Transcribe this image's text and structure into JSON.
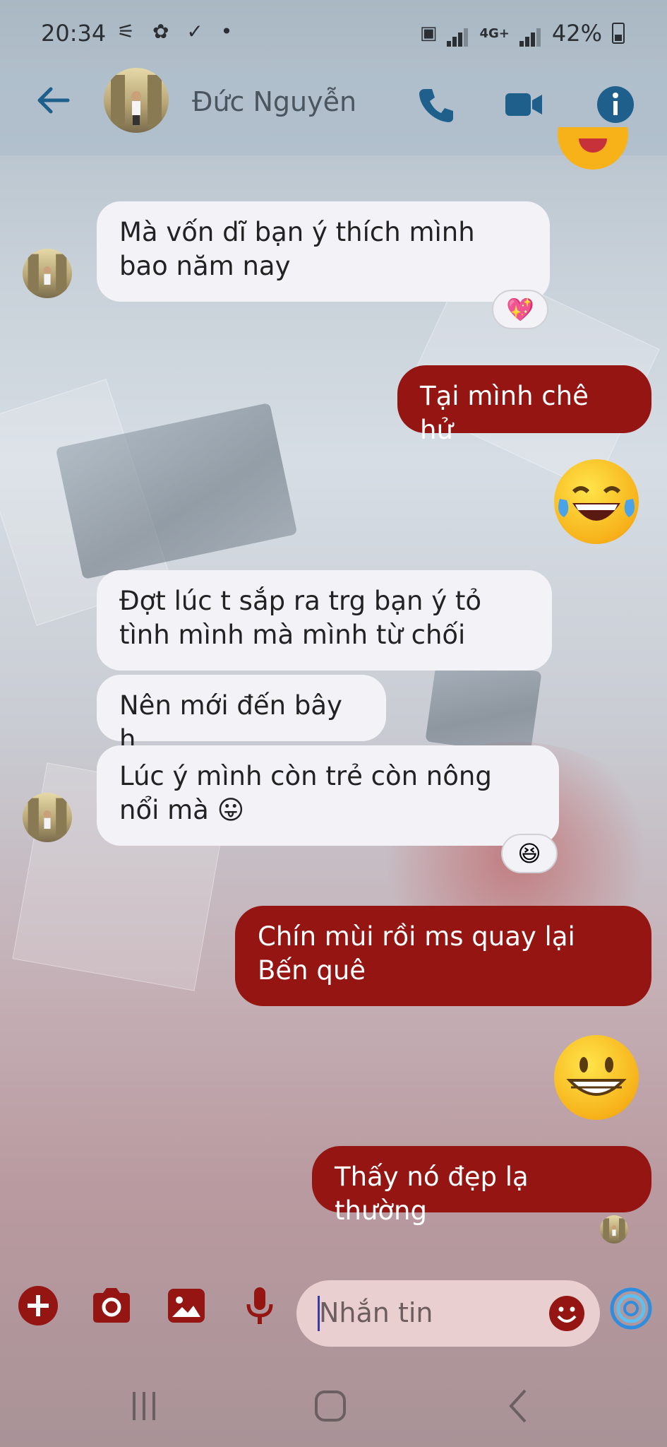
{
  "status_bar": {
    "time": "20:34",
    "left_icons": "⚟ ✿ ✓ •",
    "network": "4G+",
    "battery": "42%"
  },
  "header": {
    "contact_name": "Đức Nguyễn",
    "icons": [
      "back-arrow-icon",
      "phone-icon",
      "video-call-icon",
      "info-icon"
    ],
    "accent_color": "#1e5f8c"
  },
  "messages": [
    {
      "side": "in",
      "text": "Mà vốn dĩ bạn ý thích mình bao năm nay",
      "reaction": "💖"
    },
    {
      "side": "out",
      "text": "Tại mình chê hử"
    },
    {
      "side": "out",
      "emoji": "😂"
    },
    {
      "side": "in",
      "text": "Đợt lúc t sắp ra trg bạn ý tỏ tình mình mà mình từ chối"
    },
    {
      "side": "in",
      "text": "Nên mới đến bây h"
    },
    {
      "side": "in",
      "text": "Lúc ý mình còn trẻ còn nông nổi mà 😛",
      "reaction": "😆"
    },
    {
      "side": "out",
      "text": "Chín mùi rồi ms quay lại Bến quê"
    },
    {
      "side": "out",
      "emoji": "😁"
    },
    {
      "side": "out",
      "text": "Thấy nó đẹp lạ thường"
    }
  ],
  "composer": {
    "placeholder": "Nhắn tin",
    "icons": [
      "add-icon",
      "camera-icon",
      "gallery-icon",
      "microphone-icon",
      "emoji-icon",
      "ai-assistant-icon"
    ],
    "accent_color": "#951513"
  },
  "colors": {
    "outgoing_bubble": "#951513",
    "incoming_bubble": "#f2f2f7"
  }
}
